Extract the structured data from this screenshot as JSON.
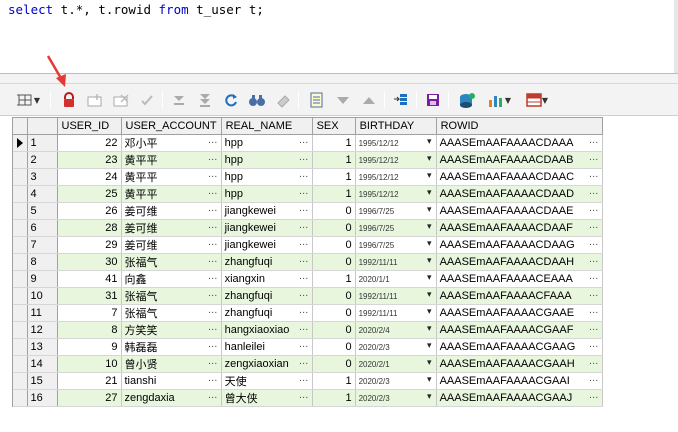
{
  "editor": {
    "sql_parts": [
      "select",
      " t.*, t.rowid ",
      "from",
      " t_user t;"
    ]
  },
  "toolbar": {
    "icons": [
      "grid-options-icon",
      "lock-icon",
      "insert-record-icon",
      "delete-record-icon",
      "post-changes-icon",
      "fetch-next-page-icon",
      "fetch-last-page-icon",
      "refresh-icon",
      "find-icon",
      "clear-record-icon",
      "query-by-example-icon",
      "next-query-icon",
      "previous-query-icon",
      "single-record-view-icon",
      "save-icon",
      "export-results-icon",
      "chart-icon",
      "table-format-icon"
    ]
  },
  "grid": {
    "columns": [
      "USER_ID",
      "USER_ACCOUNT",
      "REAL_NAME",
      "SEX",
      "BIRTHDAY",
      "ROWID"
    ],
    "rows": [
      {
        "n": "1",
        "id": "22",
        "account": "邓小平",
        "real": "hpp",
        "sex": "1",
        "birthday": "1995/12/12",
        "rowid": "AAASEmAAFAAAACDAAA"
      },
      {
        "n": "2",
        "id": "23",
        "account": "黄平平",
        "real": "hpp",
        "sex": "1",
        "birthday": "1995/12/12",
        "rowid": "AAASEmAAFAAAACDAAB"
      },
      {
        "n": "3",
        "id": "24",
        "account": "黄平平",
        "real": "hpp",
        "sex": "1",
        "birthday": "1995/12/12",
        "rowid": "AAASEmAAFAAAACDAAC"
      },
      {
        "n": "4",
        "id": "25",
        "account": "黄平平",
        "real": "hpp",
        "sex": "1",
        "birthday": "1995/12/12",
        "rowid": "AAASEmAAFAAAACDAAD"
      },
      {
        "n": "5",
        "id": "26",
        "account": "姜可维",
        "real": "jiangkewei",
        "sex": "0",
        "birthday": "1996/7/25",
        "rowid": "AAASEmAAFAAAACDAAE"
      },
      {
        "n": "6",
        "id": "28",
        "account": "姜可维",
        "real": "jiangkewei",
        "sex": "0",
        "birthday": "1996/7/25",
        "rowid": "AAASEmAAFAAAACDAAF"
      },
      {
        "n": "7",
        "id": "29",
        "account": "姜可维",
        "real": "jiangkewei",
        "sex": "0",
        "birthday": "1996/7/25",
        "rowid": "AAASEmAAFAAAACDAAG"
      },
      {
        "n": "8",
        "id": "30",
        "account": "张福气",
        "real": "zhangfuqi",
        "sex": "0",
        "birthday": "1992/11/11",
        "rowid": "AAASEmAAFAAAACDAAH"
      },
      {
        "n": "9",
        "id": "41",
        "account": "向鑫",
        "real": "xiangxin",
        "sex": "1",
        "birthday": "2020/1/1",
        "rowid": "AAASEmAAFAAAACEAAA"
      },
      {
        "n": "10",
        "id": "31",
        "account": "张福气",
        "real": "zhangfuqi",
        "sex": "0",
        "birthday": "1992/11/11",
        "rowid": "AAASEmAAFAAAACFAAA"
      },
      {
        "n": "11",
        "id": "7",
        "account": "张福气",
        "real": "zhangfuqi",
        "sex": "0",
        "birthday": "1992/11/11",
        "rowid": "AAASEmAAFAAAACGAAE"
      },
      {
        "n": "12",
        "id": "8",
        "account": "方笑笑",
        "real": "hangxiaoxiao",
        "sex": "0",
        "birthday": "2020/2/4",
        "rowid": "AAASEmAAFAAAACGAAF"
      },
      {
        "n": "13",
        "id": "9",
        "account": "韩磊磊",
        "real": "hanleilei",
        "sex": "0",
        "birthday": "2020/2/3",
        "rowid": "AAASEmAAFAAAACGAAG"
      },
      {
        "n": "14",
        "id": "10",
        "account": "曾小贤",
        "real": "zengxiaoxian",
        "sex": "0",
        "birthday": "2020/2/1",
        "rowid": "AAASEmAAFAAAACGAAH"
      },
      {
        "n": "15",
        "id": "21",
        "account": "tianshi",
        "real": "天使",
        "sex": "1",
        "birthday": "2020/2/3",
        "rowid": "AAASEmAAFAAAACGAAI"
      },
      {
        "n": "16",
        "id": "27",
        "account": "zengdaxia",
        "real": "曾大侠",
        "sex": "1",
        "birthday": "2020/2/3",
        "rowid": "AAASEmAAFAAAACGAAJ"
      }
    ]
  },
  "colors": {
    "keyword": "#0000c8",
    "row_alt": "#e8f6de",
    "arrow": "#e53935"
  }
}
